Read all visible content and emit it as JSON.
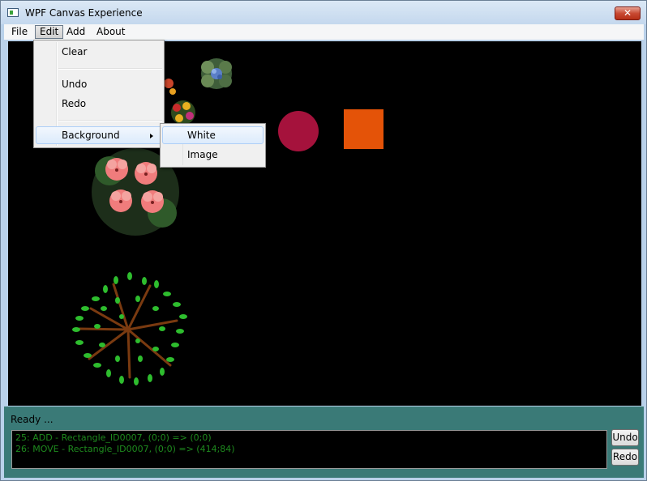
{
  "window": {
    "title": "WPF Canvas Experience",
    "close_glyph": "✕"
  },
  "menubar": {
    "items": [
      {
        "label": "File"
      },
      {
        "label": "Edit",
        "active": true
      },
      {
        "label": "Add"
      },
      {
        "label": "About"
      }
    ]
  },
  "edit_menu": {
    "items": [
      "Clear",
      "Undo",
      "Redo",
      "Background"
    ],
    "background_submenu": [
      "White",
      "Image"
    ]
  },
  "canvas": {
    "background": "#000000",
    "shapes": [
      {
        "kind": "circle",
        "color": "#a5123c"
      },
      {
        "kind": "rectangle",
        "color": "#e45308"
      },
      {
        "kind": "image",
        "icon": "flower-pot-icon"
      },
      {
        "kind": "image",
        "icon": "flower-cluster-icon"
      },
      {
        "kind": "image",
        "icon": "small-flowers-icon"
      },
      {
        "kind": "image",
        "icon": "tree-top-icon"
      }
    ]
  },
  "status": {
    "text": "Ready ..."
  },
  "log": {
    "lines": [
      "25: ADD - Rectangle_ID0007, (0;0) => (0;0)",
      "26: MOVE - Rectangle_ID0007, (0;0) => (414;84)"
    ]
  },
  "buttons": {
    "undo": "Undo",
    "redo": "Redo"
  },
  "colors": {
    "log_text": "#1e8a1e",
    "status_panel": "#3a7a77",
    "menu_highlight": "#dcebfc"
  }
}
